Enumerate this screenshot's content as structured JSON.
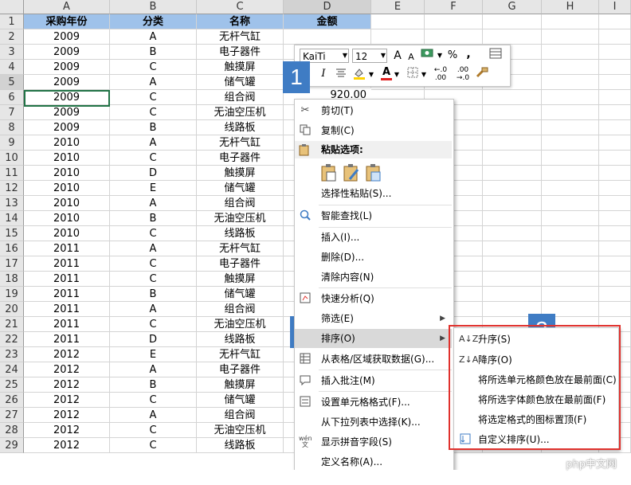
{
  "columns": [
    "A",
    "B",
    "C",
    "D",
    "E",
    "F",
    "G",
    "H",
    "I"
  ],
  "header_row": {
    "year": "采购年份",
    "category": "分类",
    "name": "名称",
    "amount": "金额"
  },
  "rows": [
    {
      "n": "2",
      "year": "2009",
      "cat": "A",
      "name": "无杆气缸"
    },
    {
      "n": "3",
      "year": "2009",
      "cat": "B",
      "name": "电子器件"
    },
    {
      "n": "4",
      "year": "2009",
      "cat": "C",
      "name": "触摸屏"
    },
    {
      "n": "5",
      "year": "2009",
      "cat": "A",
      "name": "储气罐"
    },
    {
      "n": "6",
      "year": "2009",
      "cat": "C",
      "name": "组合阀"
    },
    {
      "n": "7",
      "year": "2009",
      "cat": "C",
      "name": "无油空压机"
    },
    {
      "n": "8",
      "year": "2009",
      "cat": "B",
      "name": "线路板"
    },
    {
      "n": "9",
      "year": "2010",
      "cat": "A",
      "name": "无杆气缸"
    },
    {
      "n": "10",
      "year": "2010",
      "cat": "C",
      "name": "电子器件"
    },
    {
      "n": "11",
      "year": "2010",
      "cat": "D",
      "name": "触摸屏"
    },
    {
      "n": "12",
      "year": "2010",
      "cat": "E",
      "name": "储气罐"
    },
    {
      "n": "13",
      "year": "2010",
      "cat": "A",
      "name": "组合阀"
    },
    {
      "n": "14",
      "year": "2010",
      "cat": "B",
      "name": "无油空压机"
    },
    {
      "n": "15",
      "year": "2010",
      "cat": "C",
      "name": "线路板"
    },
    {
      "n": "16",
      "year": "2011",
      "cat": "A",
      "name": "无杆气缸"
    },
    {
      "n": "17",
      "year": "2011",
      "cat": "C",
      "name": "电子器件"
    },
    {
      "n": "18",
      "year": "2011",
      "cat": "C",
      "name": "触摸屏"
    },
    {
      "n": "19",
      "year": "2011",
      "cat": "B",
      "name": "储气罐"
    },
    {
      "n": "20",
      "year": "2011",
      "cat": "A",
      "name": "组合阀"
    },
    {
      "n": "21",
      "year": "2011",
      "cat": "C",
      "name": "无油空压机"
    },
    {
      "n": "22",
      "year": "2011",
      "cat": "D",
      "name": "线路板"
    },
    {
      "n": "23",
      "year": "2012",
      "cat": "E",
      "name": "无杆气缸"
    },
    {
      "n": "24",
      "year": "2012",
      "cat": "A",
      "name": "电子器件"
    },
    {
      "n": "25",
      "year": "2012",
      "cat": "B",
      "name": "触摸屏"
    },
    {
      "n": "26",
      "year": "2012",
      "cat": "C",
      "name": "储气罐"
    },
    {
      "n": "27",
      "year": "2012",
      "cat": "A",
      "name": "组合阀"
    },
    {
      "n": "28",
      "year": "2012",
      "cat": "C",
      "name": "无油空压机"
    },
    {
      "n": "29",
      "year": "2012",
      "cat": "C",
      "name": "线路板"
    }
  ],
  "active_cell_value": "920.00",
  "mini_toolbar": {
    "font": "KaiTi",
    "size": "12",
    "grow": "A",
    "shrink": "A",
    "percent": "%",
    "comma": ",",
    "italic": "I",
    "font_color": "A"
  },
  "badges": {
    "one": "1",
    "two": "2",
    "three": "3"
  },
  "menu": {
    "cut": "剪切(T)",
    "copy": "复制(C)",
    "paste_options": "粘贴选项:",
    "paste_special": "选择性粘贴(S)...",
    "smart_lookup": "智能查找(L)",
    "insert": "插入(I)...",
    "delete": "删除(D)...",
    "clear": "清除内容(N)",
    "quick_analysis": "快速分析(Q)",
    "filter": "筛选(E)",
    "sort": "排序(O)",
    "get_data": "从表格/区域获取数据(G)...",
    "insert_comment": "插入批注(M)",
    "format_cells": "设置单元格格式(F)...",
    "pick_list": "从下拉列表中选择(K)...",
    "phonetic": "显示拼音字段(S)",
    "define_name": "定义名称(A)..."
  },
  "submenu": {
    "asc": "升序(S)",
    "desc": "降序(O)",
    "cell_color": "将所选单元格颜色放在最前面(C)",
    "font_color": "将所选字体颜色放在最前面(F)",
    "icon": "将选定格式的图标置顶(F)",
    "custom": "自定义排序(U)..."
  },
  "watermark": "php中文网",
  "colors": {
    "header_fill": "#9fc2ea",
    "badge": "#3f7cc4",
    "highlight_box": "#e0312d",
    "active_border": "#217346"
  }
}
